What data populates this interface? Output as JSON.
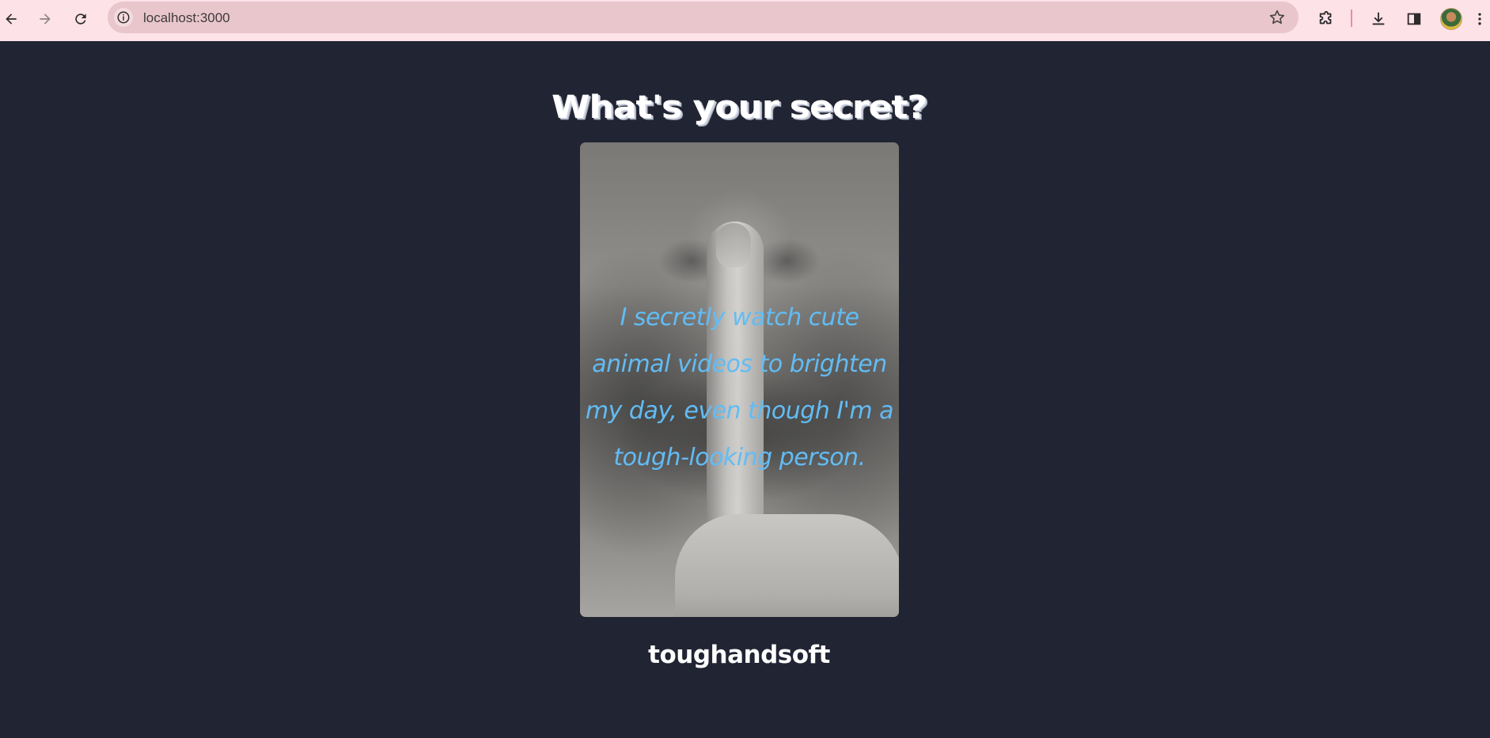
{
  "browser": {
    "url": "localhost:3000",
    "icons": [
      "back-arrow-icon",
      "forward-arrow-icon",
      "reload-icon",
      "site-info-icon",
      "bookmark-star-icon",
      "extensions-icon",
      "downloads-icon",
      "side-panel-icon",
      "profile-avatar",
      "more-menu-icon"
    ]
  },
  "page": {
    "heading": "What's your secret?",
    "secret": "I secretly watch cute animal videos to brighten my day, even though I'm a tough-looking person.",
    "username": "toughandsoft"
  },
  "colors": {
    "background": "#212432",
    "toolbar": "#fde2e8",
    "omnibox": "#e8c6cc",
    "secret_text": "#62bcf4",
    "heading": "#ffffff"
  }
}
